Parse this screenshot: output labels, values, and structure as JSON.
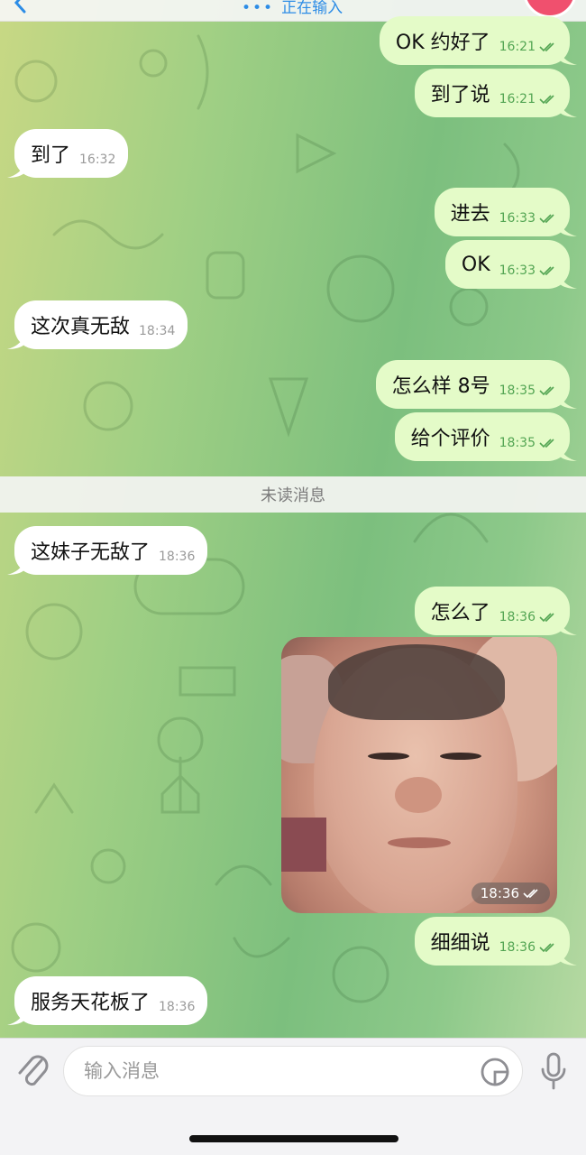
{
  "header": {
    "typing_status": "正在输入"
  },
  "messages": [
    {
      "id": "m1",
      "side": "out",
      "text": "OK 约好了",
      "time": "16:21"
    },
    {
      "id": "m2",
      "side": "out",
      "text": "到了说",
      "time": "16:21"
    },
    {
      "id": "m3",
      "side": "in",
      "text": "到了",
      "time": "16:32"
    },
    {
      "id": "m4",
      "side": "out",
      "text": "进去",
      "time": "16:33"
    },
    {
      "id": "m5",
      "side": "out",
      "text": "OK",
      "time": "16:33"
    },
    {
      "id": "m6",
      "side": "in",
      "text": "这次真无敌",
      "time": "18:34"
    },
    {
      "id": "m7",
      "side": "out",
      "text": "怎么样 8号",
      "time": "18:35"
    },
    {
      "id": "m8",
      "side": "out",
      "text": "给个评价",
      "time": "18:35"
    },
    {
      "id": "m9",
      "side": "in",
      "text": "这妹子无敌了",
      "time": "18:36"
    },
    {
      "id": "m10",
      "side": "out",
      "text": "怎么了",
      "time": "18:36"
    },
    {
      "id": "m11",
      "side": "out",
      "type": "photo",
      "time": "18:36"
    },
    {
      "id": "m12",
      "side": "out",
      "text": "细细说",
      "time": "18:36"
    },
    {
      "id": "m13",
      "side": "in",
      "text": "服务天花板了",
      "time": "18:36"
    }
  ],
  "unread_divider": "未读消息",
  "composer": {
    "placeholder": "输入消息"
  },
  "colors": {
    "outgoing_bubble": "#e4fbc8",
    "incoming_bubble": "#ffffff",
    "outgoing_meta": "#53a553",
    "accent": "#2c8ce6"
  },
  "icons": {
    "back": "chevron-left-icon",
    "attach": "paperclip-icon",
    "sticker": "sticker-icon",
    "mic": "microphone-icon",
    "read": "double-check-icon"
  }
}
